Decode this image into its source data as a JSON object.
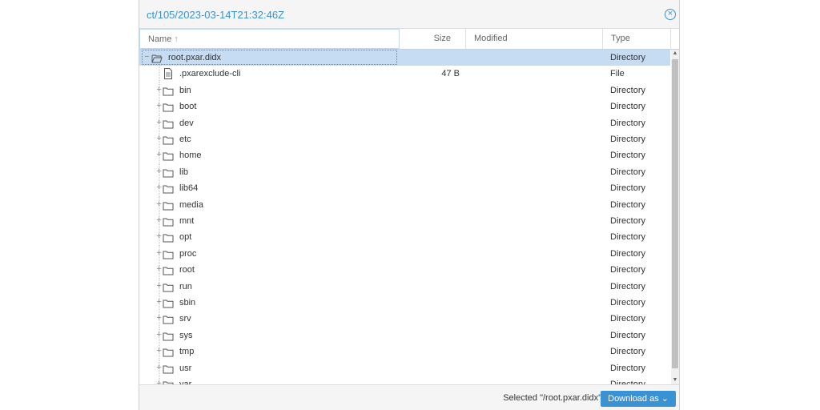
{
  "window": {
    "title": "ct/105/2023-03-14T21:32:46Z",
    "close_icon": "close-circle-icon"
  },
  "columns": {
    "name": "Name",
    "size": "Size",
    "modified": "Modified",
    "type": "Type",
    "sort_indicator": "↑"
  },
  "tree": {
    "root": {
      "name": "root.pxar.didx",
      "size": "",
      "modified": "",
      "type": "Directory",
      "expanded": true
    },
    "children": [
      {
        "name": ".pxarexclude-cli",
        "size": "47 B",
        "modified": "",
        "type": "File",
        "kind": "file"
      },
      {
        "name": "bin",
        "size": "",
        "modified": "",
        "type": "Directory",
        "kind": "folder"
      },
      {
        "name": "boot",
        "size": "",
        "modified": "",
        "type": "Directory",
        "kind": "folder"
      },
      {
        "name": "dev",
        "size": "",
        "modified": "",
        "type": "Directory",
        "kind": "folder"
      },
      {
        "name": "etc",
        "size": "",
        "modified": "",
        "type": "Directory",
        "kind": "folder"
      },
      {
        "name": "home",
        "size": "",
        "modified": "",
        "type": "Directory",
        "kind": "folder"
      },
      {
        "name": "lib",
        "size": "",
        "modified": "",
        "type": "Directory",
        "kind": "folder"
      },
      {
        "name": "lib64",
        "size": "",
        "modified": "",
        "type": "Directory",
        "kind": "folder"
      },
      {
        "name": "media",
        "size": "",
        "modified": "",
        "type": "Directory",
        "kind": "folder"
      },
      {
        "name": "mnt",
        "size": "",
        "modified": "",
        "type": "Directory",
        "kind": "folder"
      },
      {
        "name": "opt",
        "size": "",
        "modified": "",
        "type": "Directory",
        "kind": "folder"
      },
      {
        "name": "proc",
        "size": "",
        "modified": "",
        "type": "Directory",
        "kind": "folder"
      },
      {
        "name": "root",
        "size": "",
        "modified": "",
        "type": "Directory",
        "kind": "folder"
      },
      {
        "name": "run",
        "size": "",
        "modified": "",
        "type": "Directory",
        "kind": "folder"
      },
      {
        "name": "sbin",
        "size": "",
        "modified": "",
        "type": "Directory",
        "kind": "folder"
      },
      {
        "name": "srv",
        "size": "",
        "modified": "",
        "type": "Directory",
        "kind": "folder"
      },
      {
        "name": "sys",
        "size": "",
        "modified": "",
        "type": "Directory",
        "kind": "folder"
      },
      {
        "name": "tmp",
        "size": "",
        "modified": "",
        "type": "Directory",
        "kind": "folder"
      },
      {
        "name": "usr",
        "size": "",
        "modified": "",
        "type": "Directory",
        "kind": "folder"
      },
      {
        "name": "var",
        "size": "",
        "modified": "",
        "type": "Directory",
        "kind": "folder"
      }
    ]
  },
  "footer": {
    "selected_text": "Selected \"/root.pxar.didx\"",
    "download_label": "Download as",
    "download_icon": "chevron-down-icon"
  },
  "colors": {
    "accent": "#3892d4",
    "selection": "#c5dcf2"
  }
}
